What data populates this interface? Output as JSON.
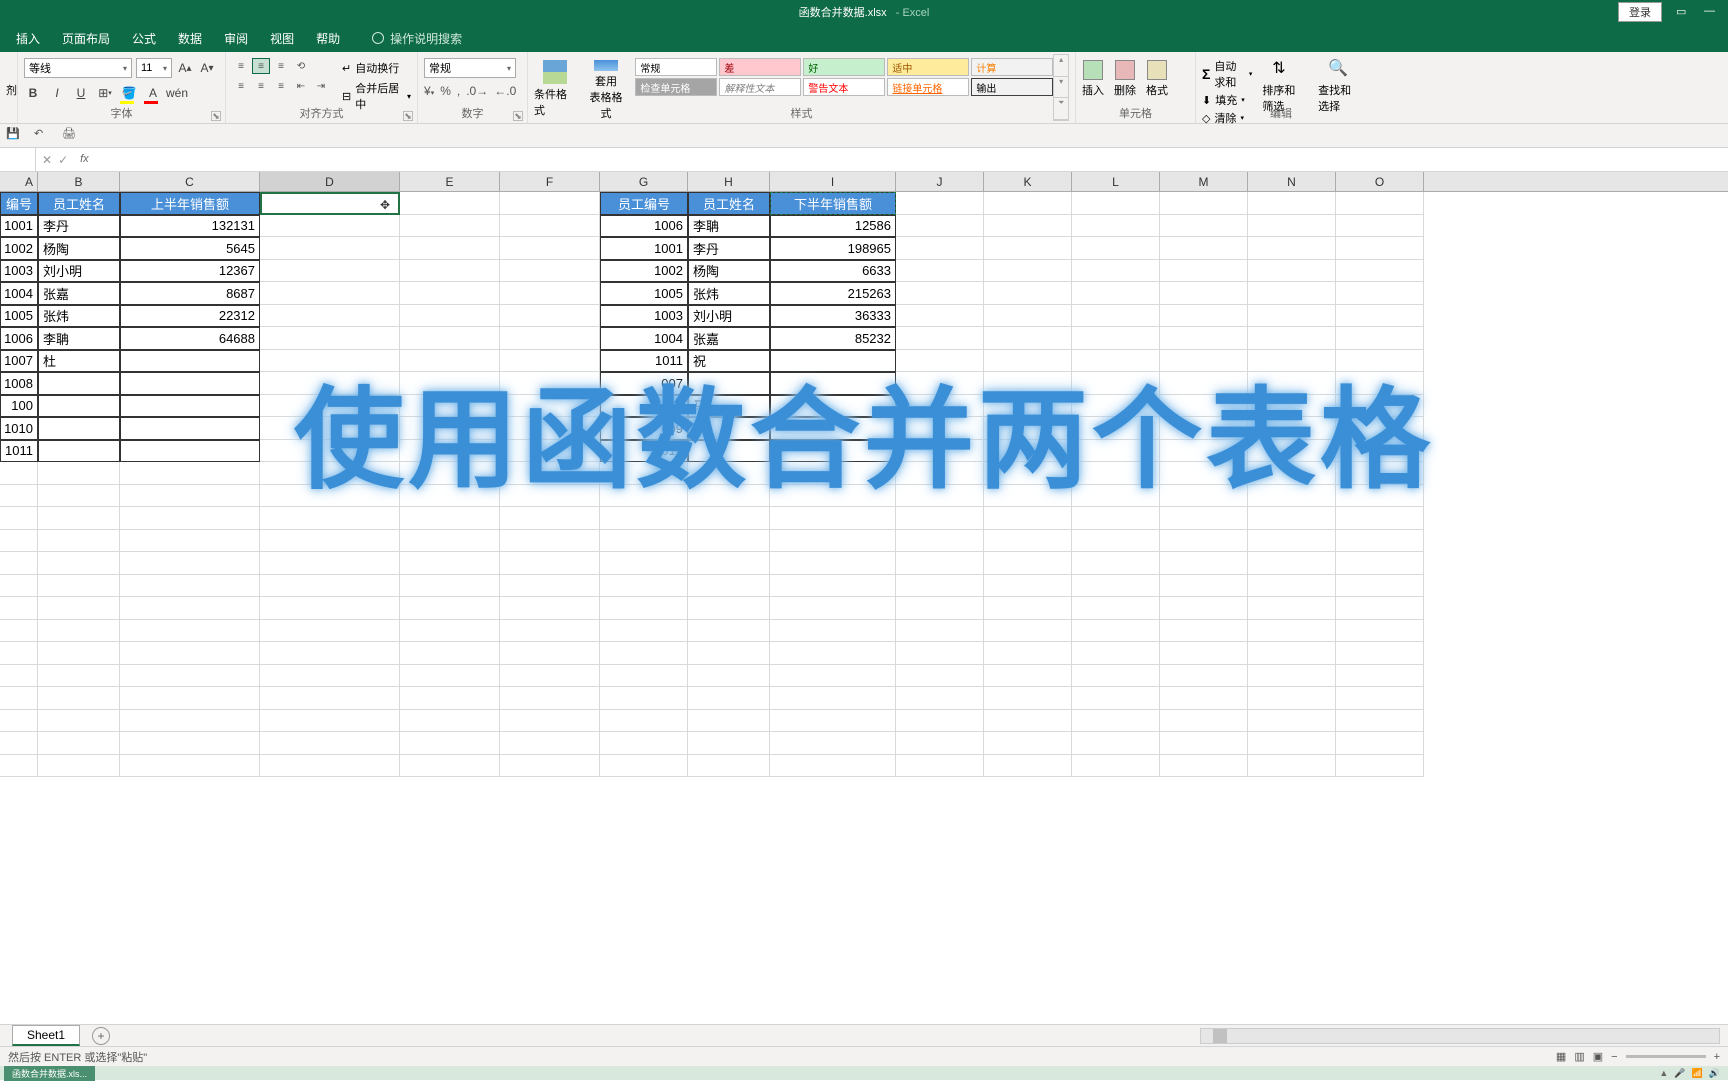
{
  "titlebar": {
    "filename": "函数合并数据.xlsx",
    "app": "Excel",
    "login": "登录"
  },
  "tabs": {
    "insert": "插入",
    "page_layout": "页面布局",
    "formulas": "公式",
    "data": "数据",
    "review": "审阅",
    "view": "视图",
    "help": "帮助",
    "tell_me": "操作说明搜索"
  },
  "ribbon": {
    "font_name": "等线",
    "font_size": "11",
    "font_label": "字体",
    "align_label": "对齐方式",
    "wrap": "自动换行",
    "merge": "合并后居中",
    "number_format": "常规",
    "number_label": "数字",
    "cond_format": "条件格式",
    "table_format": "套用\n表格格式",
    "style_label": "样式",
    "s_normal": "常规",
    "s_bad": "差",
    "s_good": "好",
    "s_neutral": "适中",
    "s_check": "检查单元格",
    "s_explain": "解释性文本",
    "s_warn": "警告文本",
    "s_link": "链接单元格",
    "s_output": "输出",
    "s_calc": "计算",
    "insert_cell": "插入",
    "delete_cell": "删除",
    "format_cell": "格式",
    "cell_label": "单元格",
    "autosum": "自动求和",
    "fill": "填充",
    "clear": "清除",
    "sort_filter": "排序和筛选",
    "find_select": "查找和选择",
    "edit_label": "编辑"
  },
  "columns": [
    "A",
    "B",
    "C",
    "D",
    "E",
    "F",
    "G",
    "H",
    "I",
    "J",
    "K",
    "L",
    "M",
    "N",
    "O"
  ],
  "table1": {
    "headers": [
      "编号",
      "员工姓名",
      "上半年销售额"
    ],
    "rows": [
      [
        "1001",
        "李丹",
        "132131"
      ],
      [
        "1002",
        "杨陶",
        "5645"
      ],
      [
        "1003",
        "刘小明",
        "12367"
      ],
      [
        "1004",
        "张嘉",
        "8687"
      ],
      [
        "1005",
        "张炜",
        "22312"
      ],
      [
        "1006",
        "李聃",
        "64688"
      ],
      [
        "1007",
        "杜",
        ""
      ],
      [
        "1008",
        "",
        ""
      ],
      [
        "100",
        "",
        ""
      ],
      [
        "1010",
        "",
        ""
      ],
      [
        "1011",
        "",
        ""
      ]
    ]
  },
  "table2": {
    "headers": [
      "员工编号",
      "员工姓名",
      "下半年销售额"
    ],
    "rows": [
      [
        "1006",
        "李聃",
        "12586"
      ],
      [
        "1001",
        "李丹",
        "198965"
      ],
      [
        "1002",
        "杨陶",
        "6633"
      ],
      [
        "1005",
        "张炜",
        "215263"
      ],
      [
        "1003",
        "刘小明",
        "36333"
      ],
      [
        "1004",
        "张嘉",
        "85232"
      ],
      [
        "1011",
        "祝",
        ""
      ],
      [
        "007",
        "",
        ""
      ],
      [
        "",
        "马",
        ""
      ],
      [
        "009",
        "",
        ""
      ],
      [
        "010",
        "",
        ""
      ]
    ]
  },
  "overlay": "使用函数合并两个表格",
  "sheet": {
    "name": "Sheet1"
  },
  "status": {
    "text": "然后按 ENTER 或选择\"粘贴\""
  },
  "taskbar": {
    "app": "函数合并数据.xls..."
  }
}
